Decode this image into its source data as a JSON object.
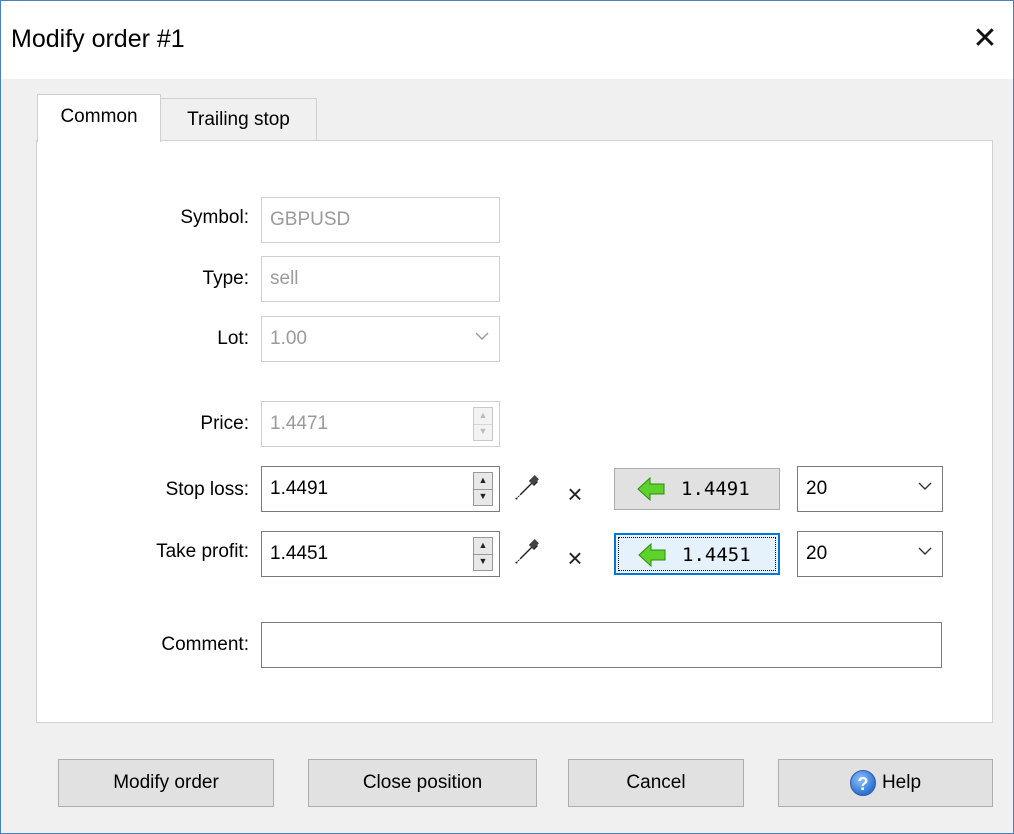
{
  "window": {
    "title": "Modify order #1"
  },
  "tabs": [
    {
      "label": "Common"
    },
    {
      "label": "Trailing stop"
    }
  ],
  "form": {
    "symbol": {
      "label": "Symbol:",
      "value": "GBPUSD"
    },
    "type": {
      "label": "Type:",
      "value": "sell"
    },
    "lot": {
      "label": "Lot:",
      "value": "1.00"
    },
    "price": {
      "label": "Price:",
      "value": "1.4471"
    },
    "stop_loss": {
      "label": "Stop loss:",
      "value": "1.4491",
      "quick_value": "1.4491",
      "points": "20",
      "clear_glyph": "×"
    },
    "take_profit": {
      "label": "Take profit:",
      "value": "1.4451",
      "quick_value": "1.4451",
      "points": "20",
      "clear_glyph": "×"
    },
    "comment": {
      "label": "Comment:",
      "value": ""
    }
  },
  "buttons": {
    "modify": "Modify order",
    "close_position": "Close position",
    "cancel": "Cancel",
    "help": "Help",
    "help_glyph": "?"
  },
  "colors": {
    "focus_border": "#0078d7",
    "arrow_green": "#5cd22a",
    "window_border": "#4a7fc0"
  },
  "icons": {
    "close": "close-icon",
    "picker": "eyedropper-icon",
    "arrow": "left-arrow-icon",
    "help": "help-icon"
  }
}
